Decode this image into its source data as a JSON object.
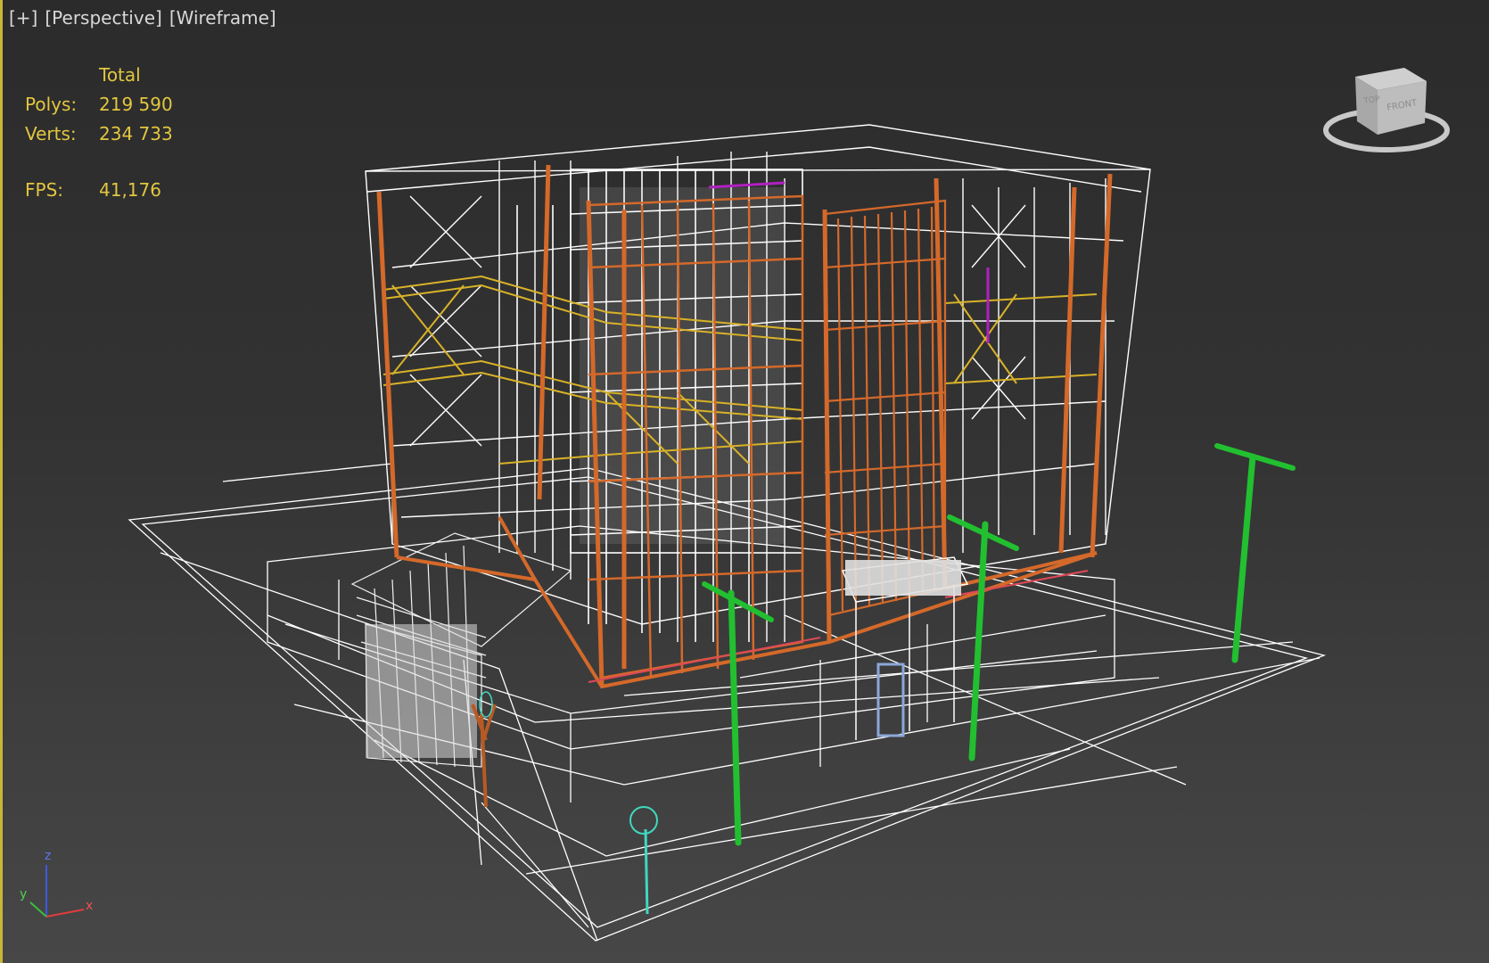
{
  "viewport": {
    "labels": [
      "[+]",
      "[Perspective]",
      "[Wireframe]"
    ],
    "stats": {
      "header": "Total",
      "polys_label": "Polys:",
      "polys_value": "219 590",
      "verts_label": "Verts:",
      "verts_value": "234 733",
      "fps_label": "FPS:",
      "fps_value": "41,176"
    },
    "viewcube": {
      "face_top": "TOP",
      "face_front": "FRONT"
    },
    "axis": {
      "z": "z",
      "y": "y",
      "x": "x"
    }
  },
  "colors": {
    "stats_text": "#e2c640",
    "wire_white": "#ffffff",
    "wire_orange": "#d4692a",
    "wire_yellow": "#d8b228",
    "lamp_green": "#22c030",
    "lamp_teal": "#40d8c0",
    "wire_purple": "#b020c0",
    "active_border": "#c8b63a"
  }
}
